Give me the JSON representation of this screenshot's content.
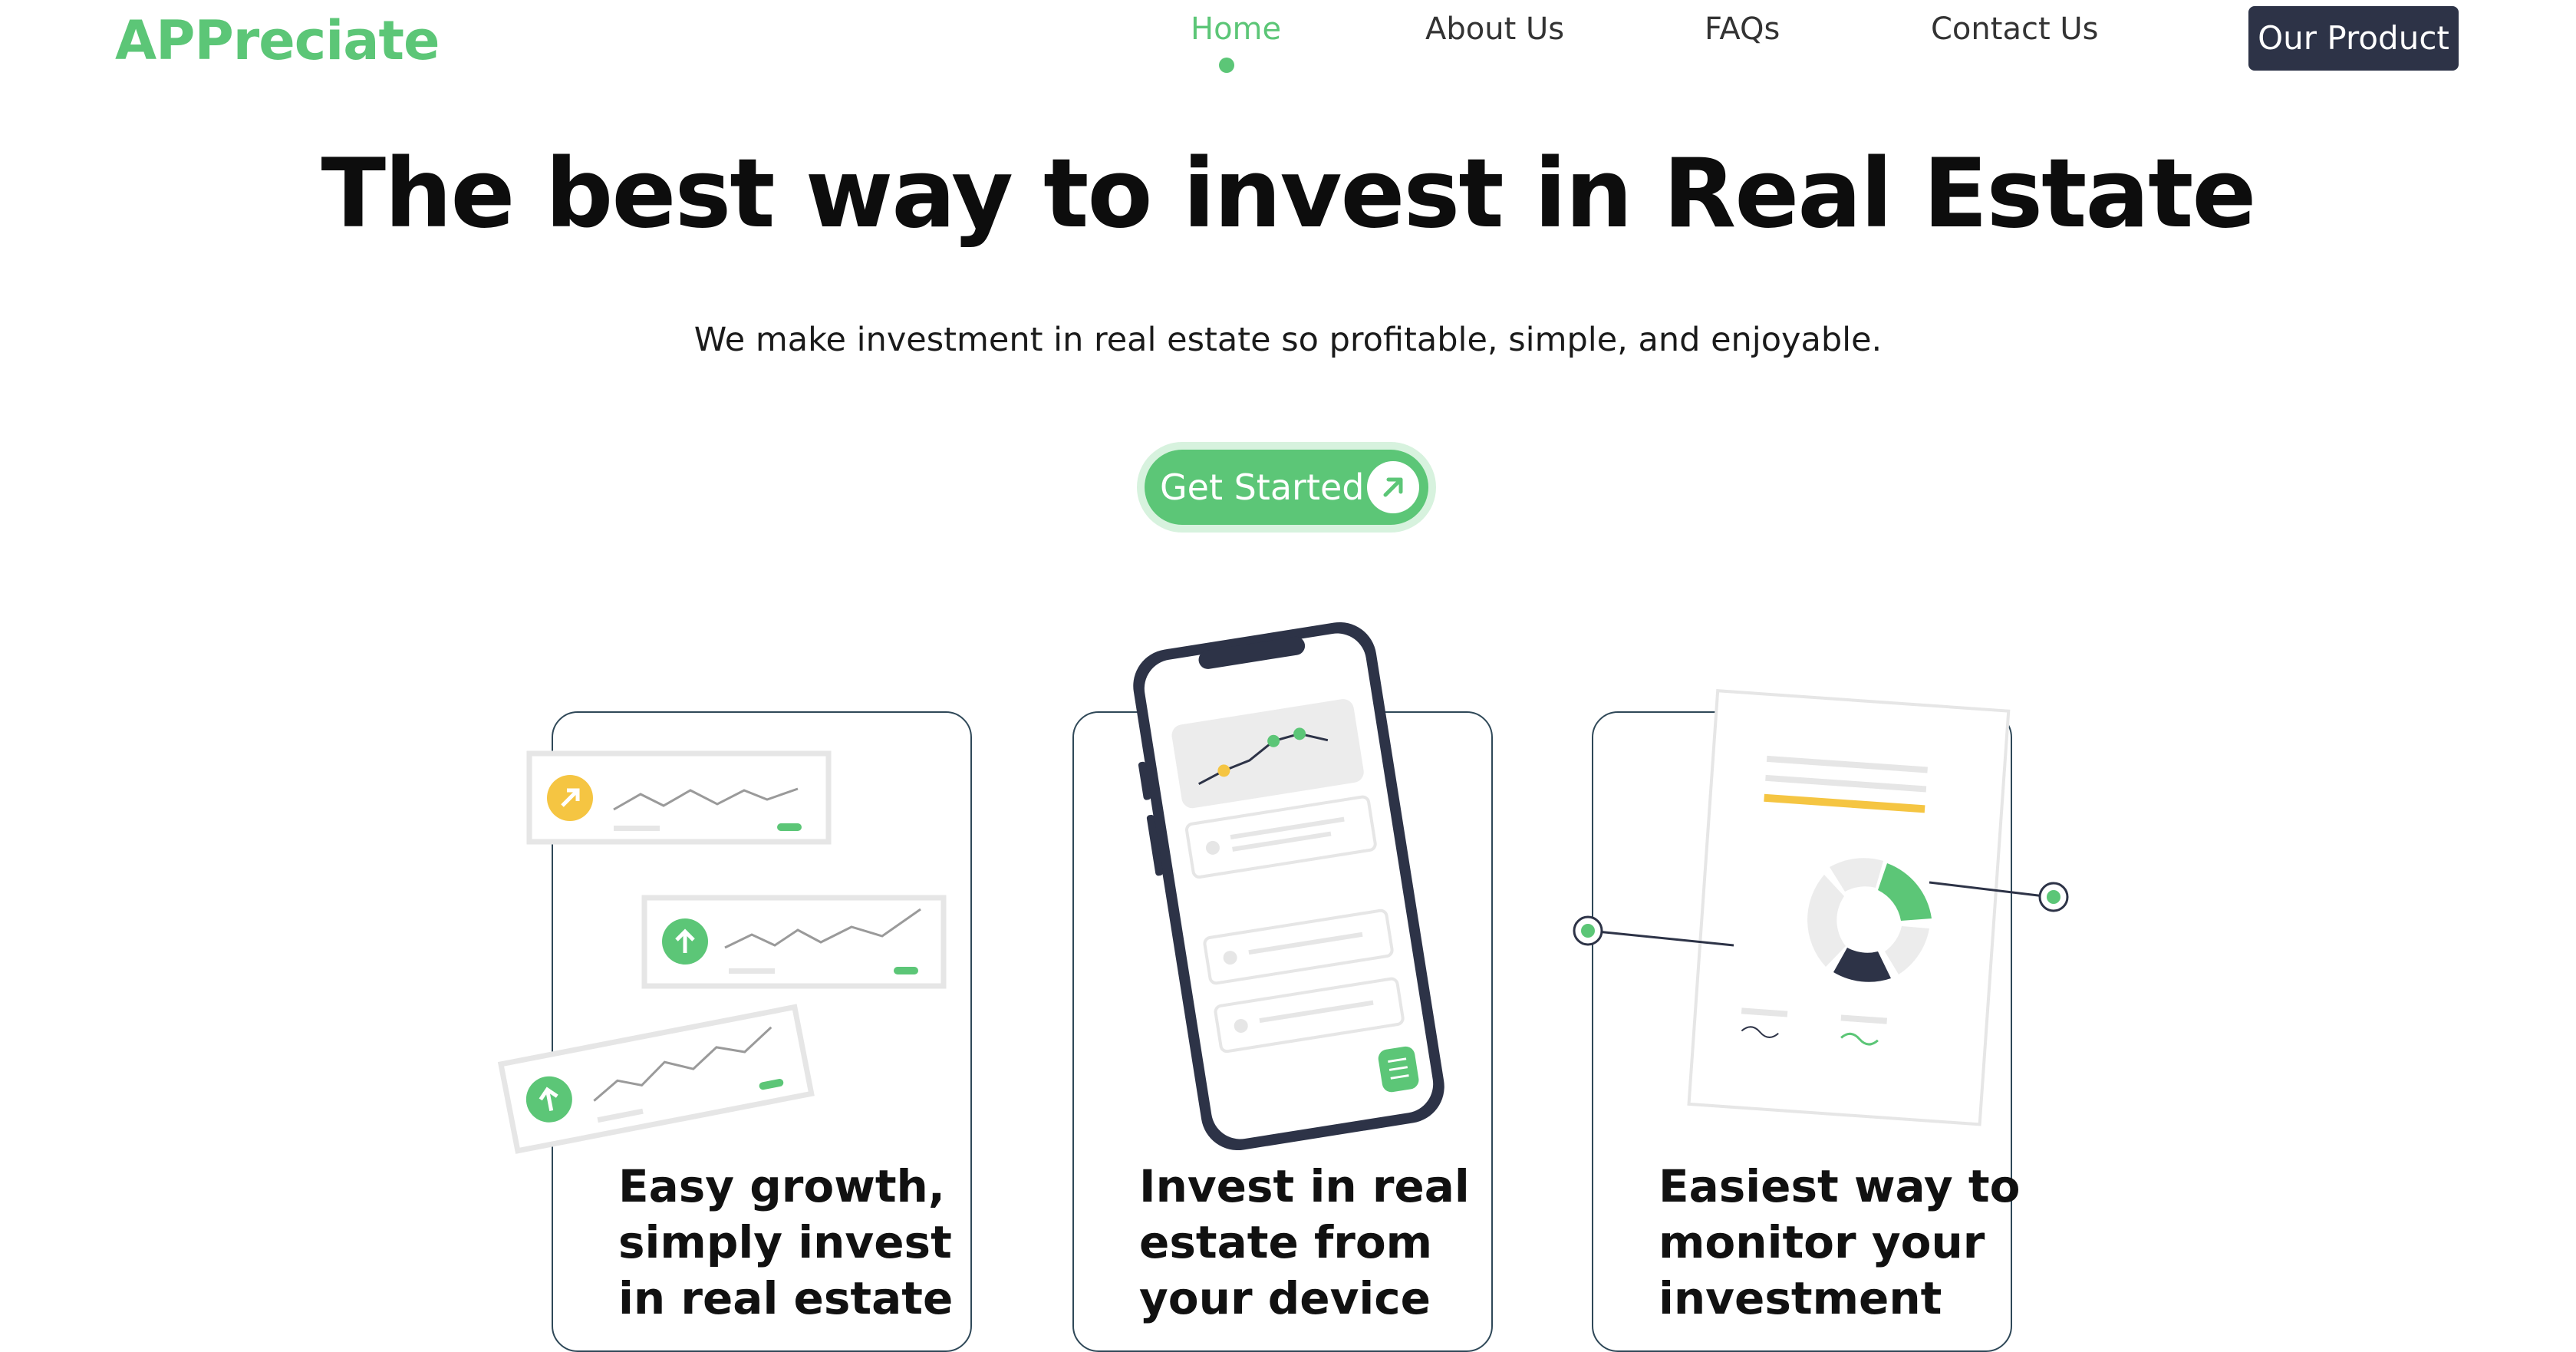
{
  "header": {
    "logo": "APPreciate",
    "nav": [
      {
        "label": "Home",
        "active": true
      },
      {
        "label": "About Us",
        "active": false
      },
      {
        "label": "FAQs",
        "active": false
      },
      {
        "label": "Contact Us",
        "active": false
      }
    ],
    "product_button": "Our Product"
  },
  "hero": {
    "title": "The best way to invest in Real Estate",
    "subtitle": "We make investment in real estate so profitable, simple, and enjoyable.",
    "cta_label": "Get Started",
    "cta_icon": "arrow-up-right-icon"
  },
  "cards": [
    {
      "lines": [
        "Easy growth,",
        "simply invest",
        "in real estate"
      ],
      "illustration": "growth-charts-illustration"
    },
    {
      "lines": [
        "Invest in real",
        "estate from",
        "your device"
      ],
      "illustration": "phone-illustration"
    },
    {
      "lines": [
        "Easiest way to",
        "monitor your",
        "investment"
      ],
      "illustration": "report-illustration"
    }
  ],
  "colors": {
    "brand_green": "#5cc677",
    "dark_navy": "#2d3347",
    "accent_yellow": "#f5c542",
    "card_border": "#2f4858"
  }
}
